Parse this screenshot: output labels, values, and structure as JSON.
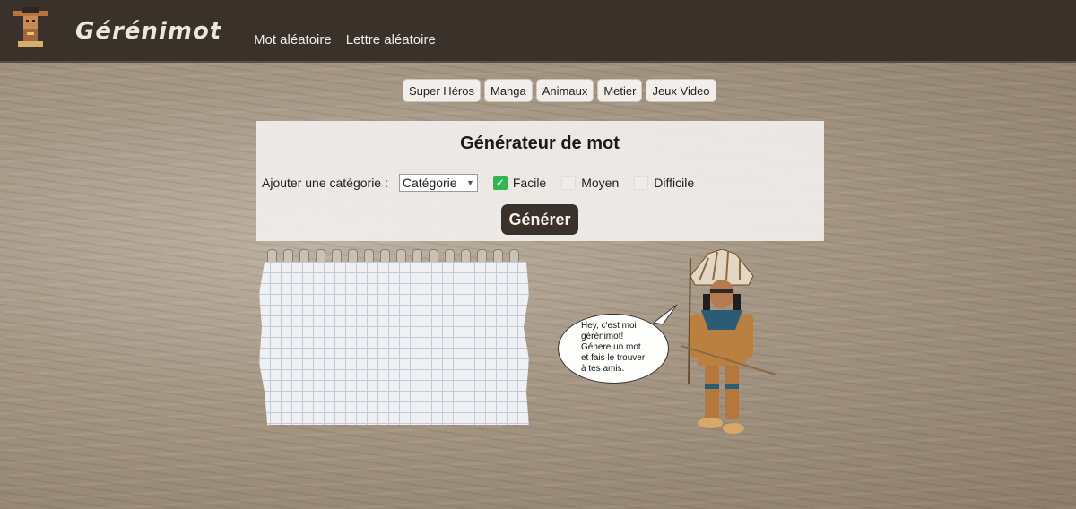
{
  "header": {
    "brand": "Gérénimot",
    "nav": [
      "Mot aléatoire",
      "Lettre aléatoire"
    ],
    "logo_icon": "totem-icon"
  },
  "categories": [
    "Super Héros",
    "Manga",
    "Animaux",
    "Metier",
    "Jeux Video"
  ],
  "generator": {
    "title": "Générateur de mot",
    "add_label": "Ajouter une catégorie :",
    "select_value": "Catégorie",
    "levels": [
      {
        "label": "Facile",
        "checked": true
      },
      {
        "label": "Moyen",
        "checked": false
      },
      {
        "label": "Difficile",
        "checked": false
      }
    ],
    "button": "Générer"
  },
  "bubble": {
    "lines": [
      "Hey, c'est moi",
      "gérénimot!",
      "Génere un mot",
      "et fais le trouver",
      "à tes amis."
    ]
  },
  "colors": {
    "header_bg": "#3a312a",
    "accent_green": "#2fb84f",
    "button_bg": "#3a312a"
  }
}
